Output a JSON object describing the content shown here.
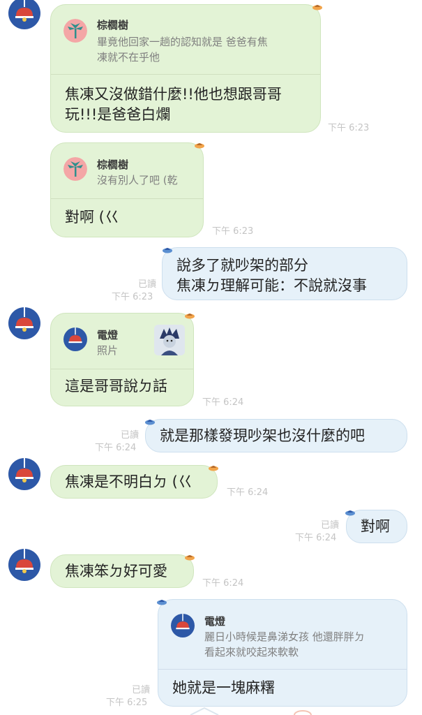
{
  "messages": [
    {
      "id": "m1",
      "direction": "in",
      "quote": {
        "name": "棕櫚樹",
        "text": "畢竟他回家一趟的認知就是 爸爸有焦\n凍就不在乎他",
        "avatar_icon": "palm-tree-icon"
      },
      "text": "焦凍又沒做錯什麼!!他也想跟哥哥\n玩!!!是爸爸白爛",
      "time": "下午 6:23"
    },
    {
      "id": "m2",
      "direction": "in",
      "quote": {
        "name": "棕櫚樹",
        "text": "沒有別人了吧 (乾",
        "avatar_icon": "palm-tree-icon"
      },
      "text": "對啊 (巜",
      "time": "下午 6:23"
    },
    {
      "id": "m3",
      "direction": "out",
      "read": "已讀",
      "text": "說多了就吵架的部分\n焦凍ㄉ理解可能：不說就沒事",
      "time": "下午 6:23"
    },
    {
      "id": "m4",
      "direction": "in",
      "quote": {
        "name": "電燈",
        "text": "照片",
        "avatar_icon": "lamp-icon"
      },
      "text": "這是哥哥說ㄉ話",
      "time": "下午 6:24"
    },
    {
      "id": "m5",
      "direction": "out",
      "read": "已讀",
      "text": "就是那樣發現吵架也沒什麼的吧",
      "time": "下午 6:24"
    },
    {
      "id": "m6",
      "direction": "in",
      "text": "焦凍是不明白ㄉ (巜",
      "time": "下午 6:24"
    },
    {
      "id": "m7",
      "direction": "out",
      "read": "已讀",
      "text": "對啊",
      "time": "下午 6:24"
    },
    {
      "id": "m8",
      "direction": "in",
      "text": "焦凍笨ㄉ好可愛",
      "time": "下午 6:24"
    },
    {
      "id": "m9",
      "direction": "out",
      "read": "已讀",
      "quote": {
        "name": "電燈",
        "text": "麗日小時候是鼻涕女孩 他還胖胖ㄉ\n看起來就咬起來軟軟",
        "avatar_icon": "lamp-icon"
      },
      "text": "她就是一塊麻糬",
      "time": "下午 6:25"
    }
  ],
  "colors": {
    "incoming_bubble": "#e3f3d6",
    "outgoing_bubble": "#e6f1f9",
    "avatar_bg": "#2d58a7",
    "lamp": "#d9473b",
    "palm_bg": "#f4a6a6",
    "palm": "#2f8f8c"
  }
}
